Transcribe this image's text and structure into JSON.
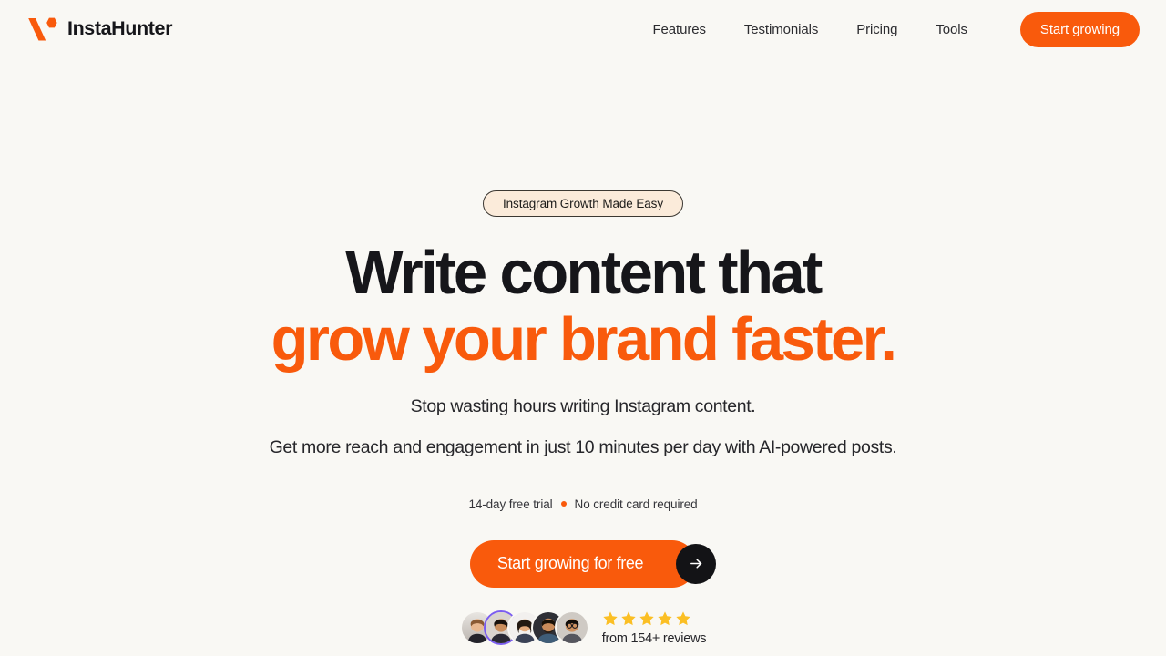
{
  "colors": {
    "background": "#F9F8F4",
    "accent_orange": "#F95A0C",
    "text_dark": "#16161a",
    "badge_bg": "#FBEBDA",
    "star_gold": "#FBBF24",
    "arrow_circle": "#131316",
    "avatar_ring": "#7a5cf0"
  },
  "header": {
    "brand_name": "InstaHunter",
    "logo_icon": "v-mark-logo-icon",
    "nav": [
      {
        "label": "Features"
      },
      {
        "label": "Testimonials"
      },
      {
        "label": "Pricing"
      },
      {
        "label": "Tools"
      }
    ],
    "cta_label": "Start growing"
  },
  "hero": {
    "badge_label": "Instagram Growth Made Easy",
    "headline_line1": "Write content that",
    "headline_line2": "grow your brand faster.",
    "subheadline_line1": "Stop wasting hours writing Instagram content.",
    "subheadline_line2": "Get more reach and engagement in just 10 minutes per day with AI-powered posts.",
    "trial_text": "14-day free trial",
    "trial_separator_icon": "orange-dot-icon",
    "no_card_text": "No credit card required",
    "cta_label": "Start growing for free",
    "cta_arrow_icon": "arrow-right-icon"
  },
  "social_proof": {
    "avatar_count": 5,
    "avatars": [
      {
        "name": "avatar-1"
      },
      {
        "name": "avatar-2"
      },
      {
        "name": "avatar-3"
      },
      {
        "name": "avatar-4"
      },
      {
        "name": "avatar-5"
      }
    ],
    "star_count": 5,
    "star_icon": "star-filled-icon",
    "reviews_text": "from 154+ reviews"
  }
}
